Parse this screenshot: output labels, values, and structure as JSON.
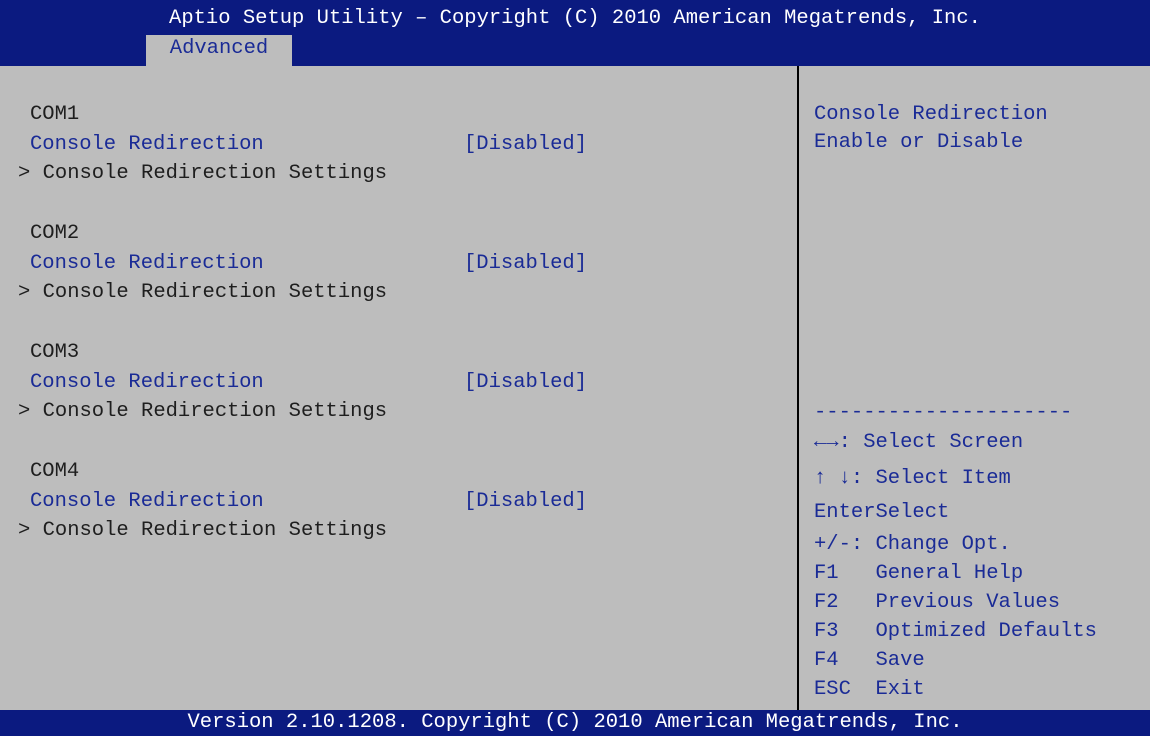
{
  "header": {
    "title": "Aptio Setup Utility – Copyright (C) 2010 American Megatrends, Inc.",
    "tab": "Advanced"
  },
  "groups": [
    {
      "heading": "COM1",
      "setting_label": "Console Redirection",
      "setting_value": "[Disabled]",
      "submenu": "> Console Redirection Settings"
    },
    {
      "heading": "COM2",
      "setting_label": "Console Redirection",
      "setting_value": "[Disabled]",
      "submenu": "> Console Redirection Settings"
    },
    {
      "heading": "COM3",
      "setting_label": "Console Redirection",
      "setting_value": "[Disabled]",
      "submenu": "> Console Redirection Settings"
    },
    {
      "heading": "COM4",
      "setting_label": "Console Redirection",
      "setting_value": "[Disabled]",
      "submenu": "> Console Redirection Settings"
    }
  ],
  "help": {
    "line1": "Console Redirection",
    "line2": "Enable or Disable"
  },
  "keys": {
    "divider": "---------------------",
    "select_screen": "←→: Select Screen",
    "select_item": "↑ ↓: Select Item",
    "enter": "EnterSelect",
    "change": "+/-: Change Opt.",
    "f1": "F1   General Help",
    "f2": "F2   Previous Values",
    "f3": "F3   Optimized Defaults",
    "f4": "F4   Save",
    "esc": "ESC  Exit"
  },
  "footer": {
    "version": "Version 2.10.1208. Copyright (C) 2010 American Megatrends, Inc."
  }
}
